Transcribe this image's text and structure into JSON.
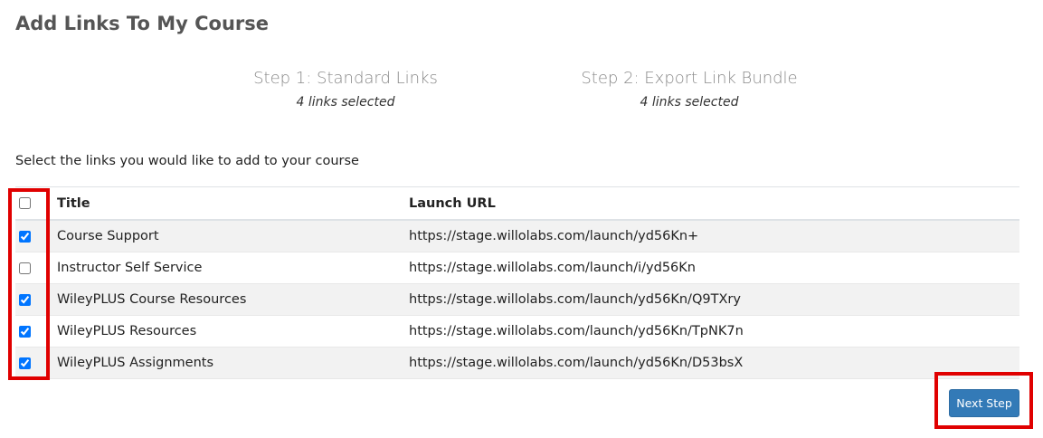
{
  "page": {
    "title": "Add Links To My Course"
  },
  "steps": [
    {
      "name": "Step 1: Standard Links",
      "status": "4 links selected"
    },
    {
      "name": "Step 2: Export Link Bundle",
      "status": "4 links selected"
    }
  ],
  "instructions": "Select the links you would like to add to your course",
  "table": {
    "headers": {
      "title": "Title",
      "url": "Launch URL"
    },
    "select_all_checked": false,
    "rows": [
      {
        "title": "Course Support",
        "url": "https://stage.willolabs.com/launch/yd56Kn+",
        "checked": true
      },
      {
        "title": "Instructor Self Service",
        "url": "https://stage.willolabs.com/launch/i/yd56Kn",
        "checked": false
      },
      {
        "title": "WileyPLUS Course Resources",
        "url": "https://stage.willolabs.com/launch/yd56Kn/Q9TXry",
        "checked": true
      },
      {
        "title": "WileyPLUS Resources",
        "url": "https://stage.willolabs.com/launch/yd56Kn/TpNK7n",
        "checked": true
      },
      {
        "title": "WileyPLUS Assignments",
        "url": "https://stage.willolabs.com/launch/yd56Kn/D53bsX",
        "checked": true
      }
    ]
  },
  "actions": {
    "next_label": "Next Step"
  },
  "colors": {
    "highlight": "#e00000",
    "primary": "#337ab7"
  }
}
